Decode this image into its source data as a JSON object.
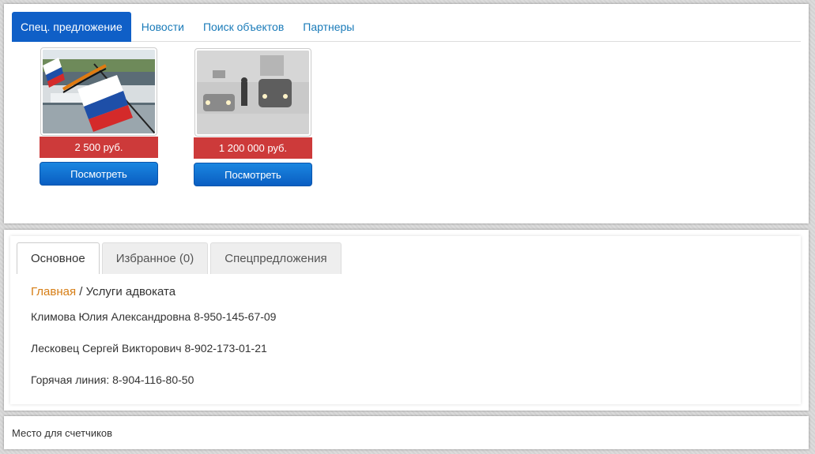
{
  "top_tabs": [
    {
      "label": "Спец. предложение",
      "active": true
    },
    {
      "label": "Новости",
      "active": false
    },
    {
      "label": "Поиск объектов",
      "active": false
    },
    {
      "label": "Партнеры",
      "active": false
    }
  ],
  "products": [
    {
      "image": "flag-car-photo",
      "price": "2 500 руб.",
      "button": "Посмотреть"
    },
    {
      "image": "snow-road-photo",
      "price": "1 200 000 руб.",
      "button": "Посмотреть"
    }
  ],
  "mid_tabs": [
    {
      "label": "Основное",
      "active": true
    },
    {
      "label": "Избранное (0)",
      "active": false
    },
    {
      "label": "Спецпредложения",
      "active": false
    }
  ],
  "breadcrumb": {
    "home": "Главная",
    "separator": " / ",
    "current": "Услуги адвоката"
  },
  "contacts": [
    "Климова Юлия Александровна 8-950-145-67-09",
    "Лесковец Сергей Викторович 8-902-173-01-21",
    "Горячая линия: 8-904-116-80-50"
  ],
  "footer": {
    "counter_text": "Место для счетчиков"
  },
  "colors": {
    "tab_active": "#0f5fc7",
    "price_bg": "#cd3a3a",
    "button": "#0a5ec2",
    "link": "#d67d14"
  }
}
